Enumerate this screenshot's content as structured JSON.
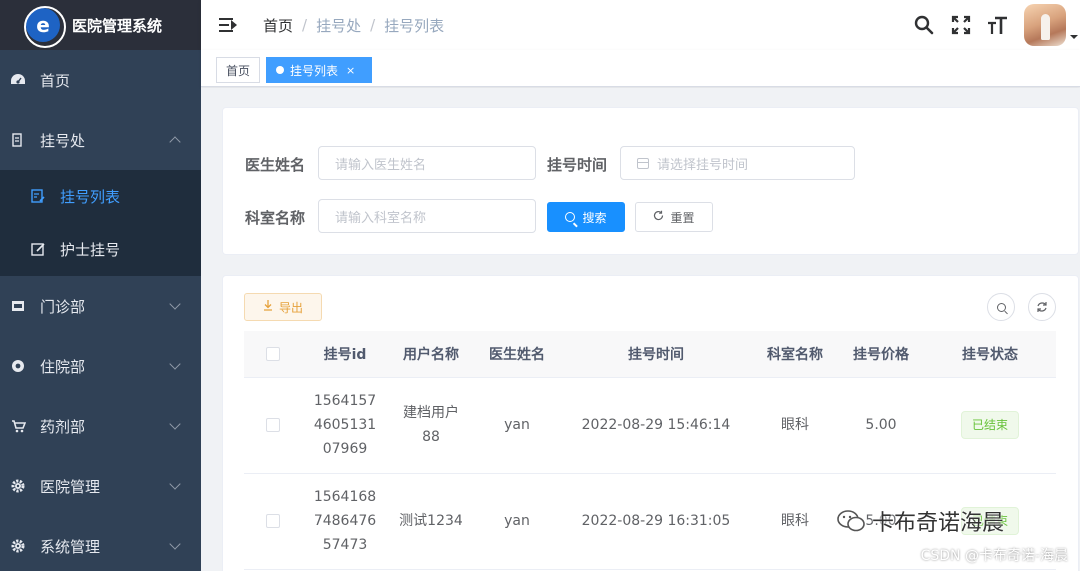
{
  "app": {
    "title": "医院管理系统",
    "logo_letter": "e"
  },
  "sidebar": {
    "items": [
      {
        "label": "首页",
        "icon": "dashboard-icon"
      },
      {
        "label": "挂号处",
        "icon": "register-icon",
        "expanded": true,
        "children": [
          {
            "label": "挂号列表",
            "icon": "list-icon",
            "active": true
          },
          {
            "label": "护士挂号",
            "icon": "edit-icon"
          }
        ]
      },
      {
        "label": "门诊部",
        "icon": "clinic-icon"
      },
      {
        "label": "住院部",
        "icon": "inpatient-icon"
      },
      {
        "label": "药剂部",
        "icon": "cart-icon"
      },
      {
        "label": "医院管理",
        "icon": "gear-icon"
      },
      {
        "label": "系统管理",
        "icon": "gear-icon"
      }
    ]
  },
  "header": {
    "breadcrumb": [
      "首页",
      "挂号处",
      "挂号列表"
    ],
    "separator": "/"
  },
  "tags": [
    {
      "label": "首页",
      "active": false
    },
    {
      "label": "挂号列表",
      "active": true,
      "close": "×"
    }
  ],
  "search": {
    "doctor_label": "医生姓名",
    "doctor_placeholder": "请输入医生姓名",
    "time_label": "挂号时间",
    "time_placeholder": "请选择挂号时间",
    "dept_label": "科室名称",
    "dept_placeholder": "请输入科室名称",
    "search_btn": "搜索",
    "reset_btn": "重置"
  },
  "toolbar": {
    "export_btn": "导出"
  },
  "table": {
    "columns": [
      "挂号id",
      "用户名称",
      "医生姓名",
      "挂号时间",
      "科室名称",
      "挂号价格",
      "挂号状态"
    ],
    "rows": [
      {
        "id": "1564157460513107969",
        "user": "建档用户88",
        "doctor": "yan",
        "time": "2022-08-29 15:46:14",
        "dept": "眼科",
        "price": "5.00",
        "status": "已结束"
      },
      {
        "id": "1564168748647657473",
        "user": "测试1234",
        "doctor": "yan",
        "time": "2022-08-29 16:31:05",
        "dept": "眼科",
        "price": "5.00",
        "status": "已结束"
      }
    ]
  },
  "watermark": {
    "text": "卡布奇诺海晨",
    "csdn": "CSDN @卡布奇诺-海晨"
  },
  "colors": {
    "sidebar": "#304156",
    "primary": "#1890ff",
    "success": "#67c23a",
    "warning": "#e6a23c"
  }
}
